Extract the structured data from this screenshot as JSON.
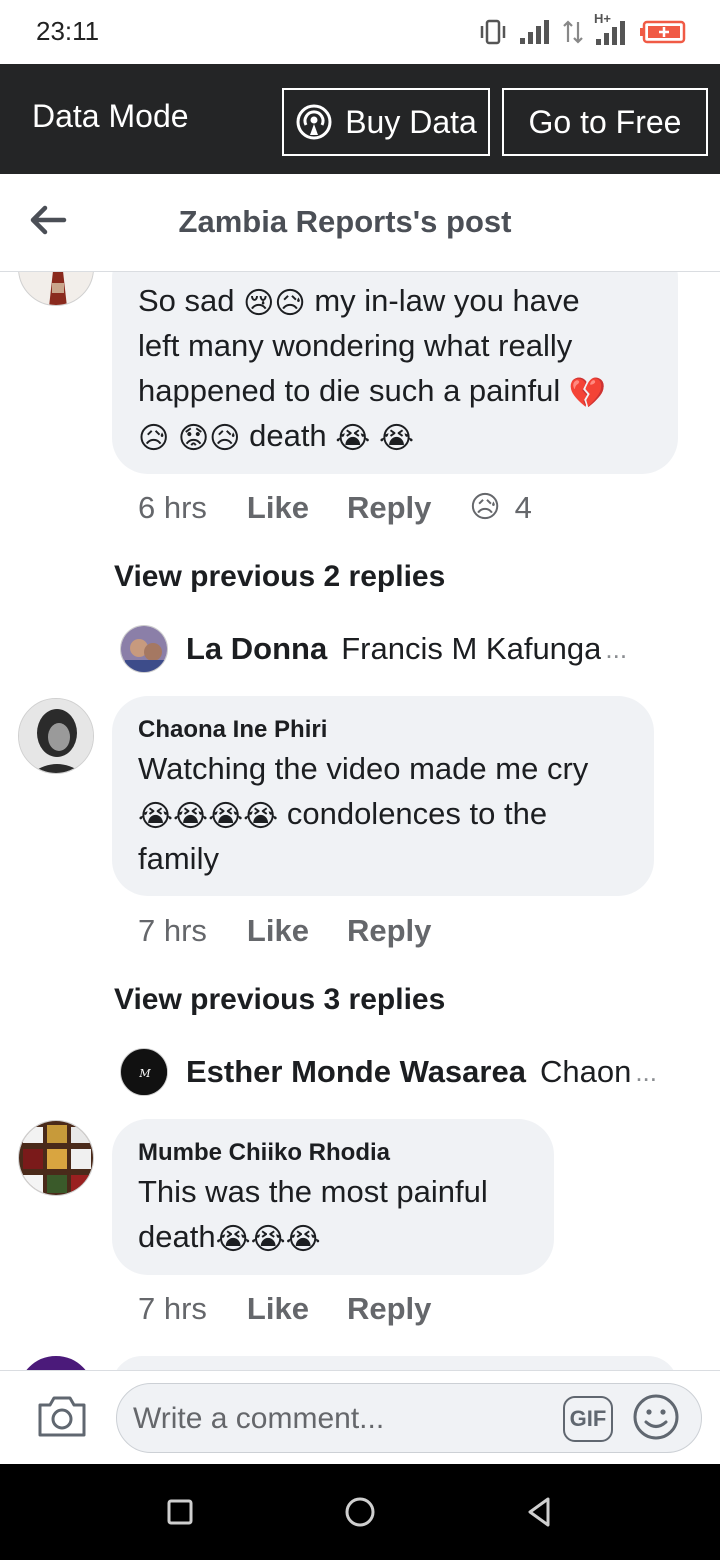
{
  "status_bar": {
    "time": "23:11",
    "network_label": "H+"
  },
  "data_bar": {
    "label": "Data Mode",
    "buy_data_label": "Buy Data",
    "go_free_label": "Go to Free"
  },
  "header": {
    "title": "Zambia Reports's post"
  },
  "comments": [
    {
      "text_lines": [
        "So sad",
        "my in-law you have",
        "left many wondering what really",
        "happened to die such a painful",
        "death"
      ],
      "time": "6 hrs",
      "like_label": "Like",
      "reply_label": "Reply",
      "reaction_count": "4"
    },
    {
      "author": "Chaona Ine Phiri",
      "text_lines": [
        "Watching the video made me cry",
        "condolences to the",
        "family"
      ],
      "time": "7 hrs",
      "like_label": "Like",
      "reply_label": "Reply"
    },
    {
      "author": "Mumbe Chiiko Rhodia",
      "text_lines": [
        "This was the most painful",
        "death"
      ],
      "time": "7 hrs",
      "like_label": "Like",
      "reply_label": "Reply"
    }
  ],
  "replies": [
    {
      "view_previous": "View previous 2 replies",
      "name": "La Donna",
      "text": "Francis M Kafunga"
    },
    {
      "view_previous": "View previous 3 replies",
      "name": "Esther Monde Wasarea",
      "text": "Chaon"
    }
  ],
  "composer": {
    "placeholder": "Write a comment...",
    "gif_label": "GIF"
  },
  "icons": {
    "back": "arrow-left-icon",
    "camera": "camera-icon",
    "smile": "smile-icon",
    "broadcast": "broadcast-icon",
    "nav_recent": "square-icon",
    "nav_home": "circle-icon",
    "nav_back": "triangle-back-icon"
  },
  "colors": {
    "data_bar_bg": "#242526",
    "bubble_bg": "#f0f2f5",
    "meta_text": "#65676b",
    "battery_accent": "#f05a45"
  }
}
